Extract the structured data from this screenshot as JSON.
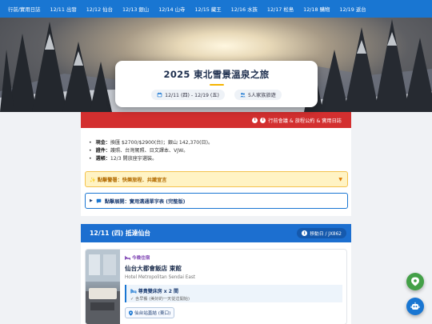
{
  "nav": {
    "items": [
      "行前/實用日誌",
      "12/11 出發",
      "12/12 仙台",
      "12/13 銀山",
      "12/14 山寺",
      "12/15 藏王",
      "12/16 水族",
      "12/17 松島",
      "12/18 購物",
      "12/19 返台"
    ]
  },
  "hero": {
    "title": "2025 東北雪景溫泉之旅",
    "dates": "12/11 (四) - 12/19 (五)",
    "party": "5人家族旅遊"
  },
  "banner": {
    "text": "行前會議 & 旅程公約 & 實用日誌"
  },
  "info": {
    "items": [
      {
        "label": "現金：",
        "text": "換匯 $2700/$2900(台)；銀山 142,370(日)。"
      },
      {
        "label": "證件：",
        "text": "護照、台灣駕照、日文譯本、VJW。"
      },
      {
        "label": "選帳：",
        "text": "12/3 開放座宇選裝。"
      }
    ],
    "warning": "✨ 點擊警署：快樂旅程．共識宣言",
    "expand": "點擊展開：實用溝通單字表 (完整版)"
  },
  "day1": {
    "title": "12/11 (四) 抵達仙台",
    "flight": "移動日 / JX862",
    "hotel": {
      "tag": "今晚住宿",
      "name": "仙台大都會飯店 東館",
      "name_en": "Hotel Metropolitan Sendai East",
      "room": "尊貴雙床房 x 2 間",
      "room_note": "含早餐 (美好的一天從這開始)",
      "station": "仙台站直結 (東口)"
    }
  },
  "colors": {
    "nav": "#1976d2",
    "banner": "#d32f2f",
    "day_header": "#1c6fd0",
    "warning_bg": "#fff3c4",
    "accent": "#f5b400"
  }
}
